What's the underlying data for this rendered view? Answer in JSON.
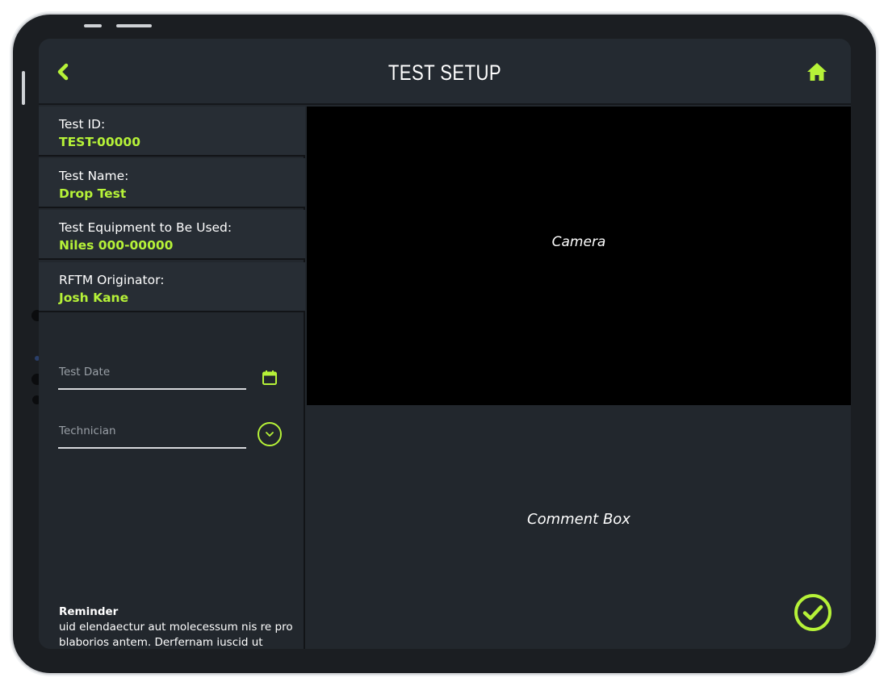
{
  "header": {
    "title": "TEST SETUP",
    "back_icon": "chevron-left-icon",
    "home_icon": "home-icon"
  },
  "info": [
    {
      "label": "Test ID:",
      "value": "TEST-00000"
    },
    {
      "label": "Test Name:",
      "value": "Drop Test"
    },
    {
      "label": "Test Equipment to Be Used:",
      "value": "Niles 000-00000"
    },
    {
      "label": "RFTM Originator:",
      "value": "Josh Kane"
    }
  ],
  "form": {
    "test_date": {
      "placeholder": "Test Date",
      "value": ""
    },
    "technician": {
      "placeholder": "Technician",
      "value": ""
    }
  },
  "reminder": {
    "title": "Reminder",
    "text": "uid elendaectur aut molecessum nis re pro blaborios antem. Derfernam iuscid ut volorestis enis eum autem"
  },
  "camera": {
    "label": "Camera"
  },
  "comment": {
    "label": "Comment Box"
  },
  "colors": {
    "accent": "#b6f238",
    "background": "#22272d",
    "header": "#242a31",
    "card": "#272d34",
    "camera": "#000000"
  }
}
